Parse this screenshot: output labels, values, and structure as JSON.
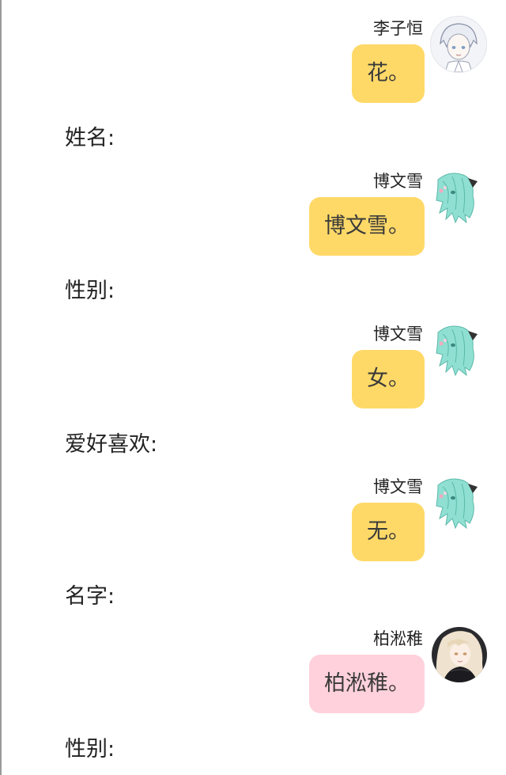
{
  "colors": {
    "bubble_yellow": "#ffd968",
    "bubble_pink": "#ffd1dc",
    "background": "#ffffff"
  },
  "messages": [
    {
      "sender": "李子恒",
      "text": "花。",
      "avatar": "white-haired-boy-avatar",
      "bubble_color": "#ffd968"
    },
    {
      "sender": "博文雪",
      "text": "博文雪。",
      "avatar": "teal-haired-girl-avatar",
      "bubble_color": "#ffd968"
    },
    {
      "sender": "博文雪",
      "text": "女。",
      "avatar": "teal-haired-girl-avatar",
      "bubble_color": "#ffd968"
    },
    {
      "sender": "博文雪",
      "text": "无。",
      "avatar": "teal-haired-girl-avatar",
      "bubble_color": "#ffd968"
    },
    {
      "sender": "柏淞稚",
      "text": "柏淞稚。",
      "avatar": "blonde-girl-avatar",
      "bubble_color": "#ffd1dc"
    }
  ],
  "prompts": [
    {
      "text": "姓名:"
    },
    {
      "text": "性别:"
    },
    {
      "text": "爱好喜欢:"
    },
    {
      "text": "名字:"
    },
    {
      "text": "性别:"
    }
  ]
}
